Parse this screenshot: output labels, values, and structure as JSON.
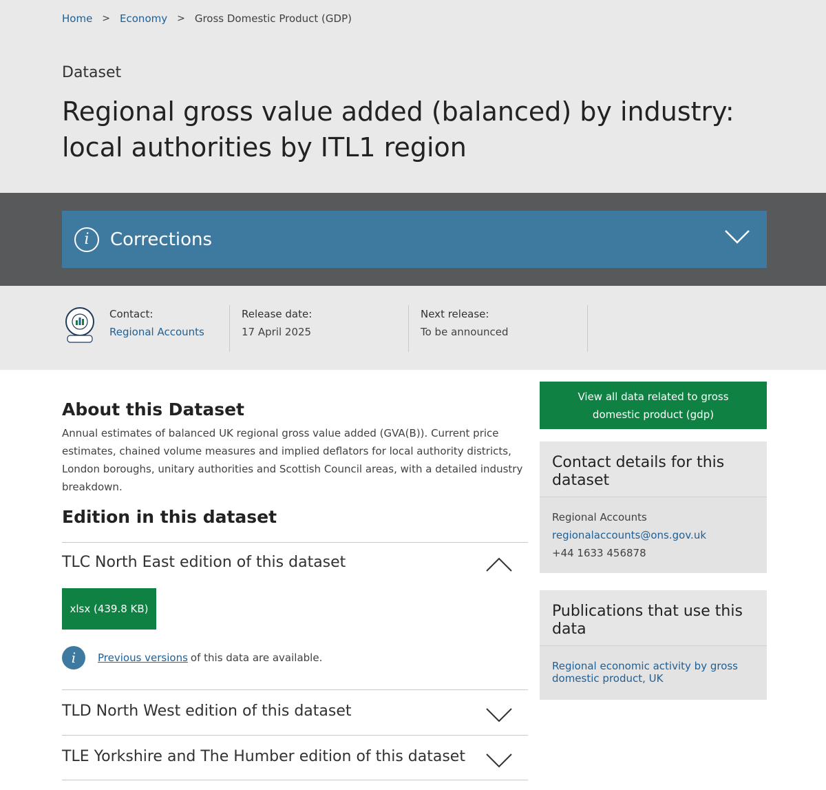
{
  "breadcrumb": {
    "items": [
      "Home",
      "Economy"
    ],
    "separator": ">",
    "current": "Gross Domestic Product (GDP)"
  },
  "header": {
    "doc_type": "Dataset",
    "title": "Regional gross value added (balanced) by industry: local authorities by ITL1 region"
  },
  "corrections": {
    "label": "Corrections",
    "icon": "info-icon"
  },
  "meta": {
    "badge_icon": "official-statistics-accredited-icon",
    "contact_label": "Contact:",
    "contact_value": "Regional Accounts",
    "release_label": "Release date:",
    "release_value": "17 April 2025",
    "next_label": "Next release:",
    "next_value": "To be announced"
  },
  "about": {
    "title": "About this Dataset",
    "text": "Annual estimates of balanced UK regional gross value added (GVA(B)). Current price estimates, chained volume measures and implied deflators for local authority districts, London boroughs, unitary authorities and Scottish Council areas, with a detailed industry breakdown."
  },
  "editions": {
    "title": "Edition in this dataset",
    "items": [
      {
        "title": "TLC North East edition of this dataset",
        "expanded": true,
        "download_label": "xlsx (439.8 KB)",
        "prev_link": "Previous versions",
        "prev_suffix": "of this data are available."
      },
      {
        "title": "TLD North West edition of this dataset",
        "expanded": false
      },
      {
        "title": "TLE Yorkshire and The Humber edition of this dataset",
        "expanded": false
      }
    ]
  },
  "sidebar": {
    "view_all_button": "View all data related to gross domestic product (gdp)",
    "contact_box": {
      "title": "Contact details for this dataset",
      "name": "Regional Accounts",
      "email": "regionalaccounts@ons.gov.uk",
      "phone": "+44 1633 456878"
    },
    "publications_box": {
      "title": "Publications that use this data",
      "link": "Regional economic activity by gross domestic product, UK"
    }
  },
  "colors": {
    "link": "#206095",
    "corrections_bg": "#3e7aa0",
    "band_dark": "#58595b",
    "band_light": "#e9e9e9",
    "button_green": "#0f8243"
  }
}
